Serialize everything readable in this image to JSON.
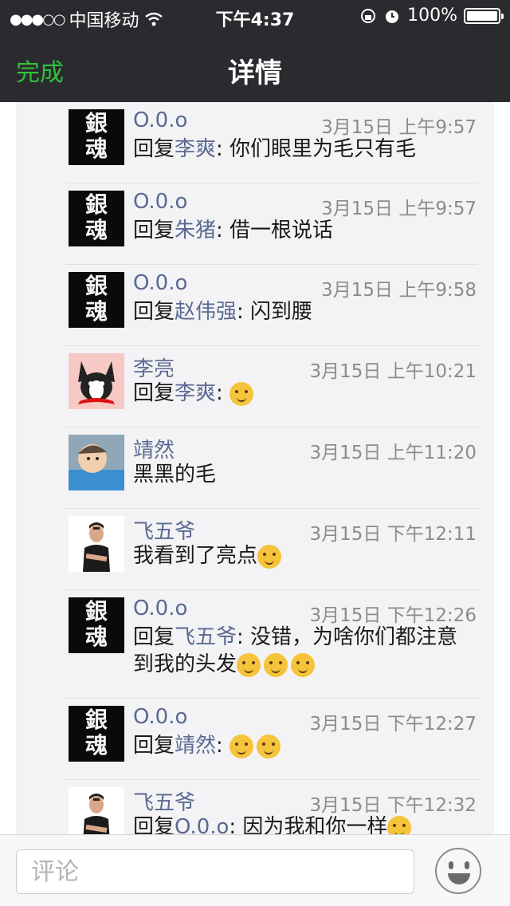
{
  "status": {
    "carrier": "中国移动",
    "time": "下午4:37",
    "battery": "100%",
    "battery_level": 1.0
  },
  "nav": {
    "done": "完成",
    "title": "详情"
  },
  "comments": [
    {
      "name": "O.0.o",
      "time": "3月15日 上午9:57",
      "avatar": "avatar-logo",
      "avatar_text": "銀魂",
      "prefix": "回复",
      "target": "李爽",
      "content": ": 你们眼里为毛只有毛"
    },
    {
      "name": "O.0.o",
      "time": "3月15日 上午9:57",
      "avatar": "avatar-logo",
      "avatar_text": "銀魂",
      "prefix": "回复",
      "target": "朱猪",
      "content": ": 借一根说话"
    },
    {
      "name": "O.0.o",
      "time": "3月15日 上午9:58",
      "avatar": "avatar-logo",
      "avatar_text": "銀魂",
      "prefix": "回复",
      "target": "赵伟强",
      "content": ": 闪到腰"
    },
    {
      "name": "李亮",
      "time": "3月15日 上午10:21",
      "avatar": "avatar-dog",
      "prefix": "回复",
      "target": "李爽",
      "content": ": ",
      "emojis": 1
    },
    {
      "name": "靖然",
      "time": "3月15日 上午11:20",
      "avatar": "avatar-baby",
      "prefix": "",
      "target": "",
      "content": "黑黑的毛"
    },
    {
      "name": "飞五爷",
      "time": "3月15日 下午12:11",
      "avatar": "avatar-man",
      "prefix": "",
      "target": "",
      "content": "我看到了亮点",
      "emojis": 1
    },
    {
      "name": "O.0.o",
      "time": "3月15日 下午12:26",
      "avatar": "avatar-logo",
      "avatar_text": "銀魂",
      "prefix": "回复",
      "target": "飞五爷",
      "content": ": 没错，为啥你们都注意到我的头发",
      "emojis": 3
    },
    {
      "name": "O.0.o",
      "time": "3月15日 下午12:27",
      "avatar": "avatar-logo",
      "avatar_text": "銀魂",
      "prefix": "回复",
      "target": "靖然",
      "content": ": ",
      "emojis": 2
    },
    {
      "name": "飞五爷",
      "time": "3月15日 下午12:32",
      "avatar": "avatar-man",
      "prefix": "回复",
      "target": "O.0.o",
      "content": ": 因为我和你一样",
      "emojis": 1
    }
  ],
  "composer": {
    "placeholder": "评论"
  },
  "colors": {
    "accent": "#2fc23a",
    "link": "#5b6a92",
    "nav_bg": "#2b2b2f"
  }
}
